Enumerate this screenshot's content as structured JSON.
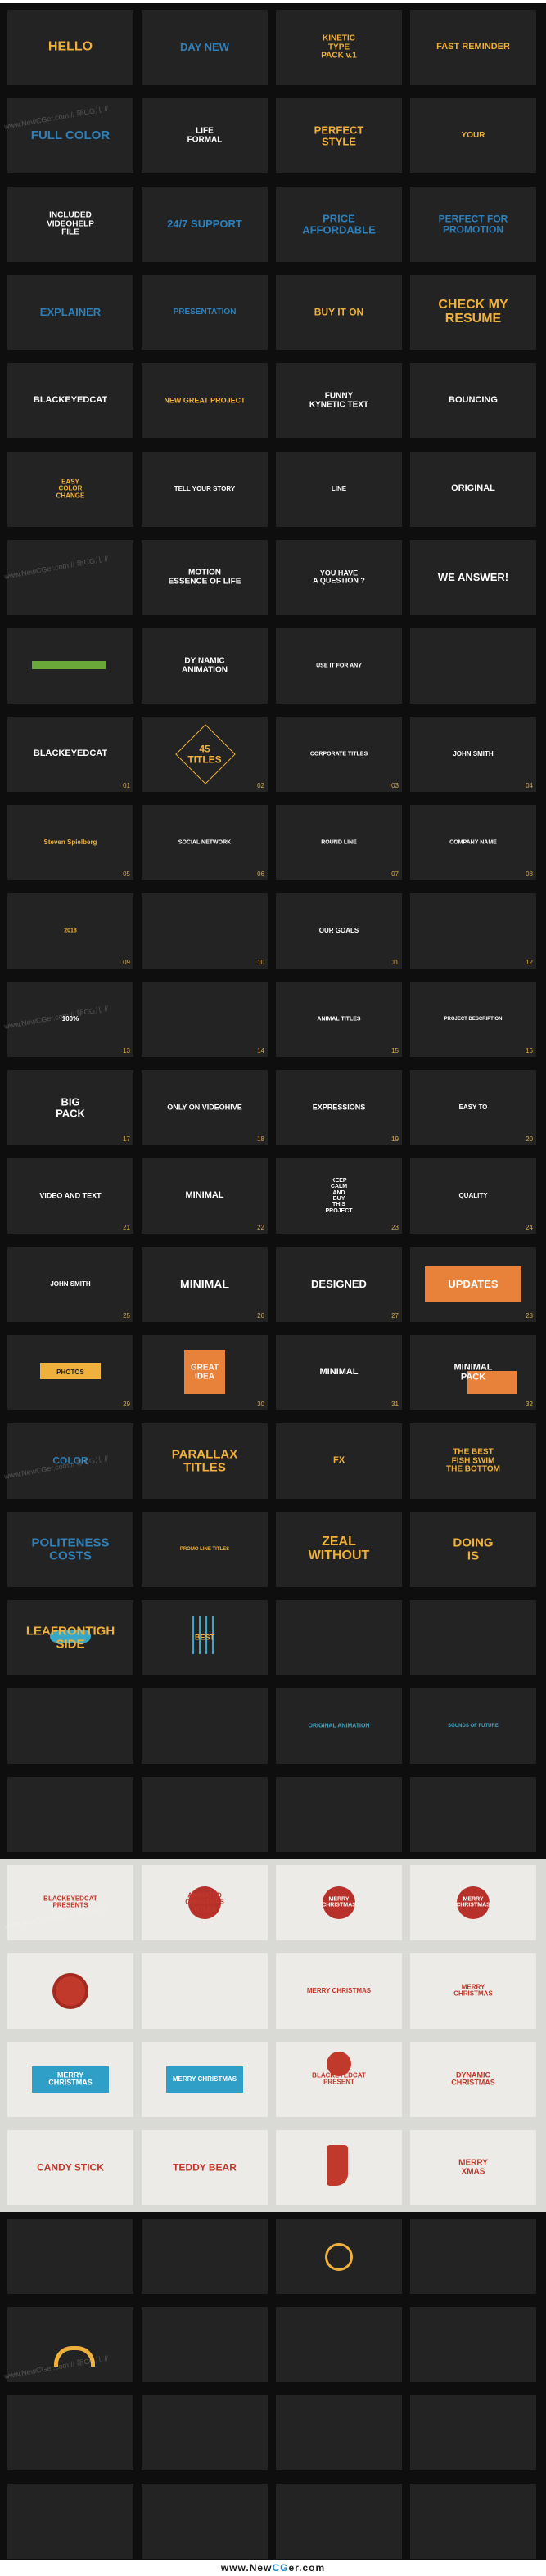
{
  "rows": [
    {
      "theme": "dark",
      "tiles": [
        {
          "text": "HELLO",
          "color": "#f0b13c",
          "size": 16
        },
        {
          "text": "DAY NEW",
          "color": "#2f7fb8",
          "size": 13
        },
        {
          "text": "KINETIC\nTYPE\nPACK v.1",
          "color": "#f0b13c",
          "size": 10
        },
        {
          "text": "FAST REMINDER",
          "color": "#f0b13c",
          "size": 11
        }
      ]
    },
    {
      "theme": "dark",
      "tiles": [
        {
          "text": "FULL COLOR",
          "color": "#2f7fb8",
          "size": 15
        },
        {
          "text": "LIFE\nFORMAL",
          "color": "#ffffff",
          "size": 10
        },
        {
          "text": "PERFECT\nSTYLE",
          "color": "#f0b13c",
          "size": 13
        },
        {
          "text": "YOUR",
          "color": "#f0b13c",
          "size": 10
        }
      ]
    },
    {
      "theme": "dark",
      "tiles": [
        {
          "text": "INCLUDED\nVIDEOHELP\nFILE",
          "color": "#ffffff",
          "size": 10
        },
        {
          "text": "24/7 SUPPORT",
          "color": "#2f7fb8",
          "size": 13
        },
        {
          "text": "PRICE\nAFFORDABLE",
          "color": "#2f7fb8",
          "size": 13
        },
        {
          "text": "PERFECT FOR\nPROMOTION",
          "color": "#2f7fb8",
          "size": 12
        }
      ]
    },
    {
      "theme": "dark",
      "tiles": [
        {
          "text": "EXPLAINER",
          "color": "#2f7fb8",
          "size": 13
        },
        {
          "text": "PRESENTATION",
          "color": "#2f7fb8",
          "size": 10
        },
        {
          "text": "BUY IT ON",
          "color": "#f0b13c",
          "size": 12
        },
        {
          "text": "CHECK MY\nRESUME",
          "color": "#f0b13c",
          "size": 16
        }
      ]
    },
    {
      "theme": "dark",
      "tiles": [
        {
          "text": "BLACKEYEDCAT",
          "color": "#ffffff",
          "size": 11
        },
        {
          "text": "NEW GREAT PROJECT",
          "color": "#f0b13c",
          "size": 9
        },
        {
          "text": "FUNNY\nKYNETIC TEXT",
          "color": "#ffffff",
          "size": 10
        },
        {
          "text": "BOUNCING",
          "color": "#ffffff",
          "size": 11
        }
      ]
    },
    {
      "theme": "dark",
      "tiles": [
        {
          "text": "EASY\nCOLOR\nCHANGE",
          "color": "#f0b13c",
          "size": 8
        },
        {
          "text": "TELL YOUR STORY",
          "color": "#ffffff",
          "size": 8
        },
        {
          "text": "LINE",
          "color": "#ffffff",
          "size": 8
        },
        {
          "text": "ORIGINAL",
          "color": "#ffffff",
          "size": 11
        }
      ]
    },
    {
      "theme": "dark",
      "tiles": [
        {
          "text": "",
          "color": "#ffffff",
          "size": 7
        },
        {
          "text": "MOTION\nESSENCE OF LIFE",
          "color": "#ffffff",
          "size": 10
        },
        {
          "text": "YOU HAVE\nA QUESTION ?",
          "color": "#ffffff",
          "size": 9
        },
        {
          "text": "WE ANSWER!",
          "color": "#ffffff",
          "size": 13
        }
      ]
    },
    {
      "theme": "dark",
      "tiles": [
        {
          "text": "",
          "color": "#6aa83a",
          "size": 8
        },
        {
          "text": "DY NAMIC\nANIMATION",
          "color": "#ffffff",
          "size": 10
        },
        {
          "text": "USE IT FOR ANY",
          "color": "#ffffff",
          "size": 7
        },
        {
          "text": "",
          "color": "#ffffff",
          "size": 8
        }
      ]
    },
    {
      "theme": "dark",
      "tiles": [
        {
          "text": "BLACKEYEDCAT",
          "color": "#ffffff",
          "size": 11,
          "num": "01"
        },
        {
          "text": "45\nTITLES",
          "color": "#f0b13c",
          "size": 12,
          "num": "02"
        },
        {
          "text": "CORPORATE TITLES",
          "color": "#ffffff",
          "size": 7,
          "num": "03"
        },
        {
          "text": "JOHN SMITH",
          "color": "#ffffff",
          "size": 8,
          "num": "04"
        }
      ]
    },
    {
      "theme": "dark",
      "tiles": [
        {
          "text": "Steven Spielberg",
          "color": "#f0b13c",
          "size": 8,
          "num": "05"
        },
        {
          "text": "SOCIAL NETWORK",
          "color": "#ffffff",
          "size": 7,
          "num": "06"
        },
        {
          "text": "ROUND LINE",
          "color": "#ffffff",
          "size": 7,
          "num": "07"
        },
        {
          "text": "COMPANY NAME",
          "color": "#ffffff",
          "size": 7,
          "num": "08"
        }
      ]
    },
    {
      "theme": "dark",
      "tiles": [
        {
          "text": "2018",
          "color": "#f0b13c",
          "size": 7,
          "num": "09"
        },
        {
          "text": "",
          "color": "#ffffff",
          "size": 7,
          "num": "10"
        },
        {
          "text": "OUR GOALS",
          "color": "#ffffff",
          "size": 8,
          "num": "11"
        },
        {
          "text": "",
          "color": "#ffffff",
          "size": 7,
          "num": "12"
        }
      ]
    },
    {
      "theme": "dark",
      "tiles": [
        {
          "text": "100%",
          "color": "#ffffff",
          "size": 8,
          "num": "13"
        },
        {
          "text": "",
          "color": "#ffffff",
          "size": 7,
          "num": "14"
        },
        {
          "text": "ANIMAL TITLES",
          "color": "#ffffff",
          "size": 7,
          "num": "15"
        },
        {
          "text": "PROJECT DESCRIPTION",
          "color": "#ffffff",
          "size": 6,
          "num": "16"
        }
      ]
    },
    {
      "theme": "dark",
      "tiles": [
        {
          "text": "BIG\nPACK",
          "color": "#ffffff",
          "size": 13,
          "num": "17"
        },
        {
          "text": "ONLY ON VIDEOHIVE",
          "color": "#ffffff",
          "size": 9,
          "num": "18"
        },
        {
          "text": "EXPRESSIONS",
          "color": "#ffffff",
          "size": 9,
          "num": "19"
        },
        {
          "text": "EASY TO",
          "color": "#ffffff",
          "size": 8,
          "num": "20"
        }
      ]
    },
    {
      "theme": "dark",
      "tiles": [
        {
          "text": "VIDEO AND TEXT",
          "color": "#ffffff",
          "size": 9,
          "num": "21"
        },
        {
          "text": "MINIMAL",
          "color": "#ffffff",
          "size": 11,
          "num": "22"
        },
        {
          "text": "KEEP\nCALM\nAND\nBUY\nTHIS\nPROJECT",
          "color": "#ffffff",
          "size": 7,
          "num": "23"
        },
        {
          "text": "QUALITY",
          "color": "#ffffff",
          "size": 8,
          "num": "24"
        }
      ]
    },
    {
      "theme": "dark",
      "tiles": [
        {
          "text": "JOHN SMITH",
          "color": "#ffffff",
          "size": 8,
          "num": "25"
        },
        {
          "text": "MINIMAL",
          "color": "#ffffff",
          "size": 14,
          "num": "26"
        },
        {
          "text": "DESIGNED",
          "color": "#ffffff",
          "size": 13,
          "num": "27"
        },
        {
          "text": "UPDATES",
          "color": "#ffffff",
          "size": 13,
          "num": "28"
        }
      ]
    },
    {
      "theme": "dark",
      "tiles": [
        {
          "text": "PHOTOS",
          "color": "#232323",
          "size": 8,
          "num": "29"
        },
        {
          "text": "GREAT\nIDEA",
          "color": "#ffffff",
          "size": 10,
          "num": "30"
        },
        {
          "text": "MINIMAL",
          "color": "#ffffff",
          "size": 11,
          "num": "31"
        },
        {
          "text": "MINIMAL\nPACK",
          "color": "#ffffff",
          "size": 11,
          "num": "32"
        }
      ]
    },
    {
      "theme": "dark",
      "tiles": [
        {
          "text": "COLOR",
          "color": "#2f7fb8",
          "size": 12
        },
        {
          "text": "PARALLAX\nTITLES",
          "color": "#f0b13c",
          "size": 15
        },
        {
          "text": "FX",
          "color": "#f0b13c",
          "size": 11
        },
        {
          "text": "THE BEST\nFISH SWIM\nTHE BOTTOM",
          "color": "#f0b13c",
          "size": 10
        }
      ]
    },
    {
      "theme": "dark",
      "tiles": [
        {
          "text": "POLITENESS\nCOSTS",
          "color": "#2f7fb8",
          "size": 15
        },
        {
          "text": "PROMO LINE TITLES",
          "color": "#f0b13c",
          "size": 6
        },
        {
          "text": "ZEAL\nWITHOUT",
          "color": "#f0b13c",
          "size": 16
        },
        {
          "text": "DOING\nIS",
          "color": "#f0b13c",
          "size": 15
        }
      ]
    },
    {
      "theme": "dark",
      "tiles": [
        {
          "text": "LEAFRONTIGH\nSIDE",
          "color": "#f0b13c",
          "size": 15
        },
        {
          "text": "BEST",
          "color": "#f0b13c",
          "size": 9
        },
        {
          "text": "",
          "color": "#ffffff",
          "size": 8
        },
        {
          "text": "",
          "color": "#ffffff",
          "size": 8
        }
      ]
    },
    {
      "theme": "dark",
      "tiles": [
        {
          "text": "",
          "color": "#39a8c8",
          "size": 8
        },
        {
          "text": "",
          "color": "#39a8c8",
          "size": 8
        },
        {
          "text": "ORIGINAL ANIMATION",
          "color": "#39a8c8",
          "size": 7
        },
        {
          "text": "SOUNDS OF FUTURE",
          "color": "#39a8c8",
          "size": 6
        }
      ]
    },
    {
      "theme": "dark",
      "tiles": [
        {
          "text": "",
          "color": "#39a8c8",
          "size": 8
        },
        {
          "text": "",
          "color": "#ffffff",
          "size": 8
        },
        {
          "text": "",
          "color": "#ffffff",
          "size": 8
        },
        {
          "text": "",
          "color": "#ffffff",
          "size": 8
        }
      ]
    },
    {
      "theme": "light",
      "tiles": [
        {
          "text": "BLACKEYEDCAT\nPRESENTS",
          "color": "#c0392b",
          "size": 8
        },
        {
          "text": "ANIMATED\nCHRISTMAS\nTITLES",
          "color": "#c0392b",
          "size": 8
        },
        {
          "text": "MERRY\nCHRISTMAS",
          "color": "#ffffff",
          "size": 7
        },
        {
          "text": "MERRY\nCHRISTMAS",
          "color": "#ffffff",
          "size": 7
        }
      ]
    },
    {
      "theme": "light",
      "tiles": [
        {
          "text": "",
          "color": "#c0392b",
          "size": 8
        },
        {
          "text": "",
          "color": "#c0392b",
          "size": 8
        },
        {
          "text": "MERRY CHRISTMAS",
          "color": "#c0392b",
          "size": 8
        },
        {
          "text": "MERRY\nCHRISTMAS",
          "color": "#c0392b",
          "size": 8
        }
      ]
    },
    {
      "theme": "light",
      "tiles": [
        {
          "text": "MERRY\nCHRISTMAS",
          "color": "#ffffff",
          "size": 9
        },
        {
          "text": "MERRY CHRISTMAS",
          "color": "#ffffff",
          "size": 8
        },
        {
          "text": "BLACKEYEDCAT\nPRESENT",
          "color": "#c0392b",
          "size": 8
        },
        {
          "text": "DYNAMIC\nCHRISTMAS",
          "color": "#c0392b",
          "size": 9
        }
      ]
    },
    {
      "theme": "light",
      "tiles": [
        {
          "text": "CANDY STICK",
          "color": "#c0392b",
          "size": 12
        },
        {
          "text": "TEDDY BEAR",
          "color": "#c0392b",
          "size": 12
        },
        {
          "text": "",
          "color": "#c0392b",
          "size": 8
        },
        {
          "text": "MERRY\nXMAS",
          "color": "#c0392b",
          "size": 10
        }
      ]
    },
    {
      "theme": "dark",
      "tiles": [
        {
          "text": "",
          "color": "#f0b13c",
          "size": 8
        },
        {
          "text": "",
          "color": "#f0b13c",
          "size": 8
        },
        {
          "text": "",
          "color": "#f0b13c",
          "size": 8
        },
        {
          "text": "",
          "color": "#f0b13c",
          "size": 8
        }
      ]
    },
    {
      "theme": "dark",
      "tiles": [
        {
          "text": "",
          "color": "#f0b13c",
          "size": 8
        },
        {
          "text": "",
          "color": "#f0b13c",
          "size": 8
        },
        {
          "text": "",
          "color": "#f0b13c",
          "size": 8
        },
        {
          "text": "",
          "color": "#f0b13c",
          "size": 8
        }
      ]
    },
    {
      "theme": "dark",
      "tiles": [
        {
          "text": "",
          "color": "#f0b13c",
          "size": 8
        },
        {
          "text": "",
          "color": "#f0b13c",
          "size": 8
        },
        {
          "text": "",
          "color": "#39a8c8",
          "size": 8
        },
        {
          "text": "",
          "color": "#39a8c8",
          "size": 8
        }
      ]
    },
    {
      "theme": "dark",
      "tiles": [
        {
          "text": "",
          "color": "#39a8c8",
          "size": 8
        },
        {
          "text": "",
          "color": "#39a8c8",
          "size": 8
        },
        {
          "text": "",
          "color": "#39a8c8",
          "size": 8
        },
        {
          "text": "",
          "color": "#39a8c8",
          "size": 8
        }
      ]
    }
  ],
  "watermark": "www.NewCGer.com // 新CG儿 //",
  "footer": {
    "prefix": "www.New",
    "brand": "CG",
    "suffix": "er.com"
  },
  "accent_colors": {
    "orange": "#f0b13c",
    "blue": "#2f7fb8",
    "red": "#c0392b",
    "cyan": "#39a8c8"
  }
}
